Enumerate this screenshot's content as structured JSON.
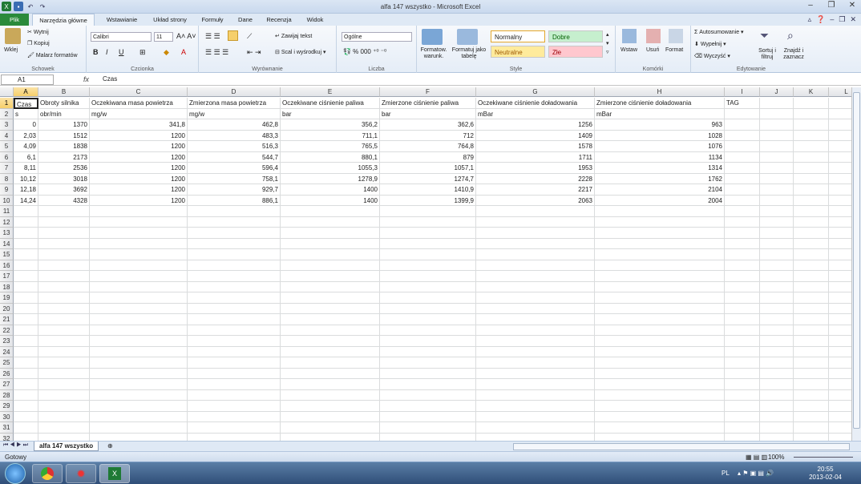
{
  "window": {
    "title": "alfa 147 wszystko  -  Microsoft Excel"
  },
  "tabs": [
    "Plik",
    "Narzędzia główne",
    "Wstawianie",
    "Układ strony",
    "Formuły",
    "Dane",
    "Recenzja",
    "Widok"
  ],
  "ribbon": {
    "clipboard": {
      "label": "Schowek",
      "paste": "Wklej",
      "cut": "Wytnij",
      "copy": "Kopiuj",
      "painter": "Malarz formatów"
    },
    "font": {
      "label": "Czcionka",
      "name": "Calibri",
      "size": "11"
    },
    "alignment": {
      "label": "Wyrównanie",
      "wrap": "Zawijaj tekst",
      "merge": "Scal i wyśrodkuj"
    },
    "number": {
      "label": "Liczba",
      "format": "Ogólne"
    },
    "styles": {
      "label": "Style",
      "cond": "Formatow. warunk.",
      "table": "Formatuj jako tabelę",
      "normal": "Normalny",
      "good": "Dobre",
      "neutral": "Neutralne",
      "bad": "Złe"
    },
    "cells": {
      "label": "Komórki",
      "insert": "Wstaw",
      "delete": "Usuń",
      "format": "Format"
    },
    "editing": {
      "label": "Edytowanie",
      "autosum": "Autosumowanie",
      "fill": "Wypełnij",
      "clear": "Wyczyść",
      "sort": "Sortuj i filtruj",
      "find": "Znajdź i zaznacz"
    }
  },
  "formula": {
    "namebox": "A1",
    "fx": "fx",
    "content": "Czas"
  },
  "columns": [
    "A",
    "B",
    "C",
    "D",
    "E",
    "F",
    "G",
    "H",
    "I",
    "J",
    "K",
    "L"
  ],
  "rows": {
    "r1": [
      "Czas",
      "Obroty silnika",
      "Oczekiwana masa powietrza",
      "Zmierzona masa powietrza",
      "Oczekiwane ciśnienie paliwa",
      "Zmierzone ciśnienie paliwa",
      "Oczekiwane ciśnienie doładowania",
      "Zmierzone ciśnienie doładowania",
      "TAG"
    ],
    "r2": [
      "s",
      "obr/min",
      "mg/w",
      "mg/w",
      "bar",
      "bar",
      "mBar",
      "mBar"
    ],
    "data": [
      [
        "0",
        "1370",
        "341,8",
        "462,8",
        "356,2",
        "362,6",
        "1256",
        "963"
      ],
      [
        "2,03",
        "1512",
        "1200",
        "483,3",
        "711,1",
        "712",
        "1409",
        "1028"
      ],
      [
        "4,09",
        "1838",
        "1200",
        "516,3",
        "765,5",
        "764,8",
        "1578",
        "1076"
      ],
      [
        "6,1",
        "2173",
        "1200",
        "544,7",
        "880,1",
        "879",
        "1711",
        "1134"
      ],
      [
        "8,11",
        "2536",
        "1200",
        "596,4",
        "1055,3",
        "1057,1",
        "1953",
        "1314"
      ],
      [
        "10,12",
        "3018",
        "1200",
        "758,1",
        "1278,9",
        "1274,7",
        "2228",
        "1762"
      ],
      [
        "12,18",
        "3692",
        "1200",
        "929,7",
        "1400",
        "1410,9",
        "2217",
        "2104"
      ],
      [
        "14,24",
        "4328",
        "1200",
        "886,1",
        "1400",
        "1399,9",
        "2063",
        "2004"
      ]
    ]
  },
  "row_numbers": [
    "1",
    "2",
    "3",
    "4",
    "5",
    "6",
    "7",
    "8",
    "9",
    "10",
    "11",
    "12",
    "13",
    "14",
    "15",
    "16",
    "17",
    "18",
    "19",
    "20",
    "21",
    "22",
    "23",
    "24",
    "25",
    "26",
    "27",
    "28",
    "29",
    "30",
    "31",
    "32"
  ],
  "sheet": {
    "name": "alfa 147 wszystko"
  },
  "status": {
    "ready": "Gotowy",
    "zoom": "100%"
  },
  "taskbar": {
    "lang": "PL",
    "time": "20:55",
    "date": "2013-02-04"
  }
}
